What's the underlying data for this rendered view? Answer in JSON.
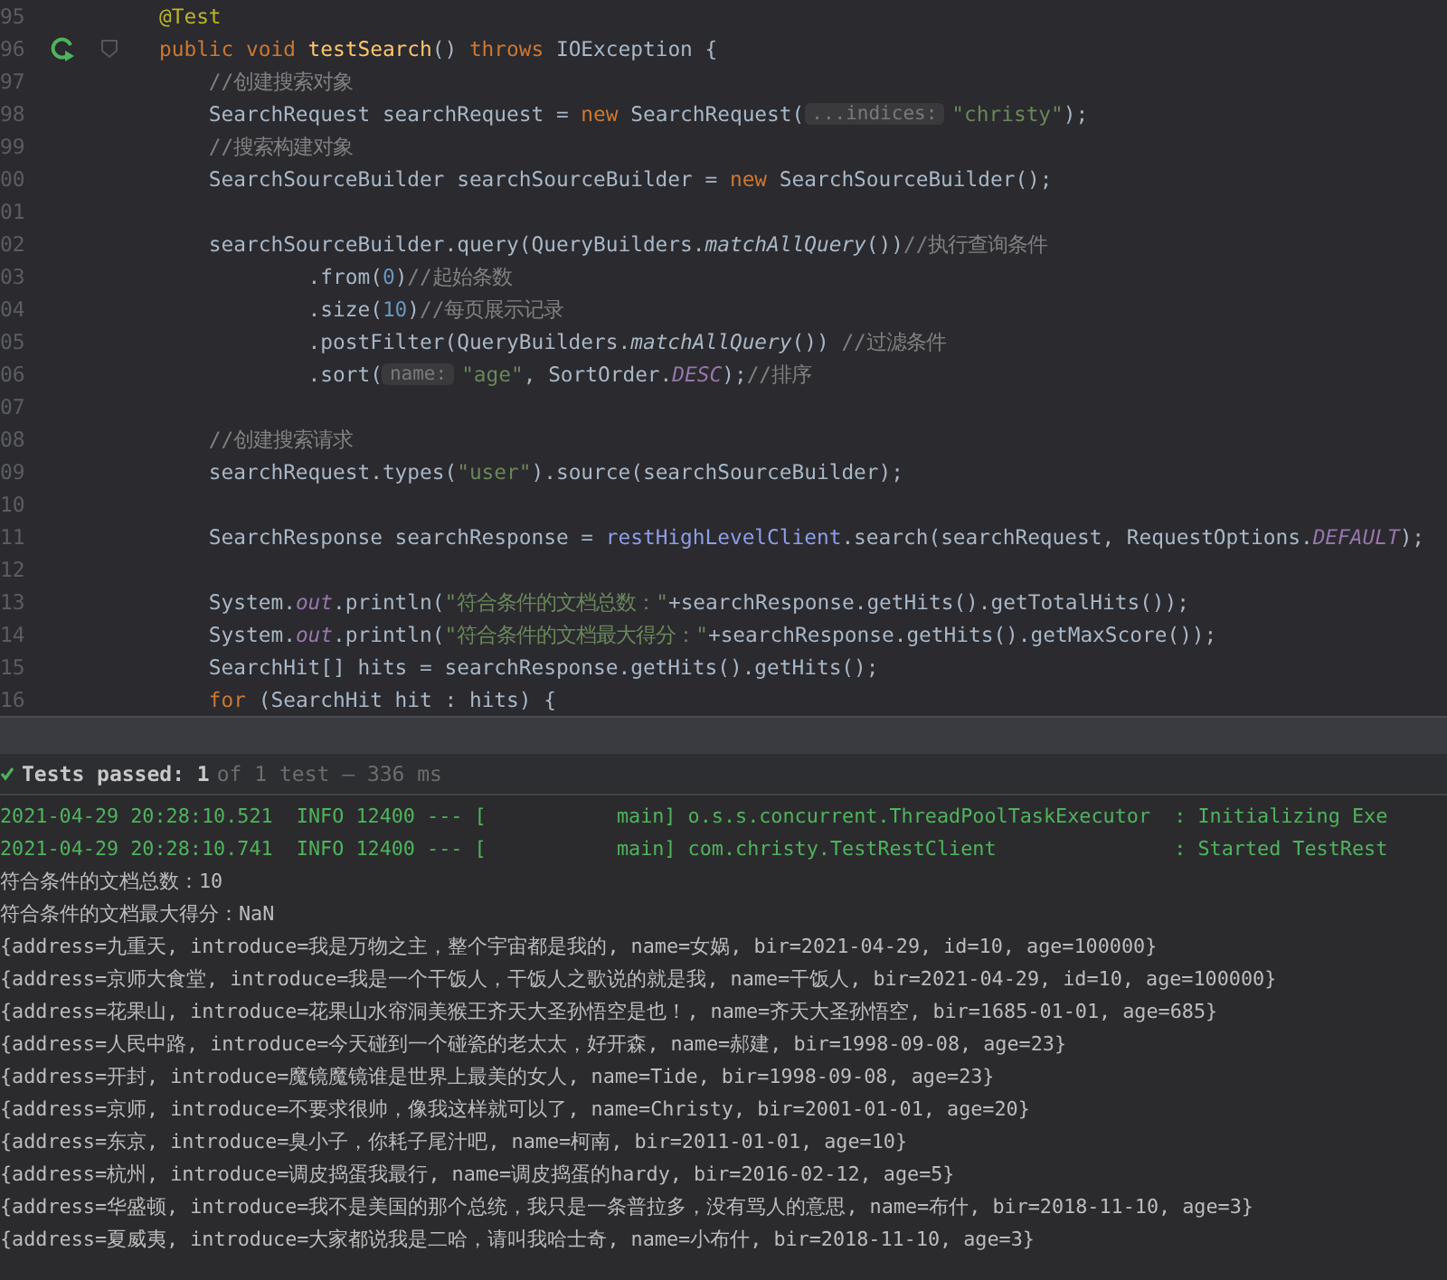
{
  "editor": {
    "lines": [
      {
        "number": "95",
        "tokens": [
          {
            "kind": "annotation",
            "text": "@Test"
          }
        ]
      },
      {
        "number": "96",
        "run_marker": true,
        "fold_marker": true,
        "tokens": [
          {
            "kind": "keyword",
            "text": "public void "
          },
          {
            "kind": "method",
            "text": "testSearch"
          },
          {
            "kind": "plain",
            "text": "() "
          },
          {
            "kind": "keyword",
            "text": "throws "
          },
          {
            "kind": "plain",
            "text": "IOException {"
          }
        ]
      },
      {
        "number": "97",
        "tokens": [
          {
            "kind": "comment",
            "text": "    //创建搜索对象"
          }
        ]
      },
      {
        "number": "98",
        "tokens": [
          {
            "kind": "plain",
            "text": "    SearchRequest searchRequest = "
          },
          {
            "kind": "keyword",
            "text": "new "
          },
          {
            "kind": "plain",
            "text": "SearchRequest("
          },
          {
            "kind": "hint",
            "text": "...indices:"
          },
          {
            "kind": "string",
            "text": "\"christy\""
          },
          {
            "kind": "plain",
            "text": ");"
          }
        ]
      },
      {
        "number": "99",
        "tokens": [
          {
            "kind": "comment",
            "text": "    //搜索构建对象"
          }
        ]
      },
      {
        "number": "00",
        "tokens": [
          {
            "kind": "plain",
            "text": "    SearchSourceBuilder searchSourceBuilder = "
          },
          {
            "kind": "keyword",
            "text": "new "
          },
          {
            "kind": "plain",
            "text": "SearchSourceBuilder();"
          }
        ]
      },
      {
        "number": "01"
      },
      {
        "number": "02",
        "tokens": [
          {
            "kind": "plain",
            "text": "    searchSourceBuilder.query(QueryBuilders."
          },
          {
            "kind": "italic",
            "text": "matchAllQuery"
          },
          {
            "kind": "plain",
            "text": "())"
          },
          {
            "kind": "comment",
            "text": "//执行查询条件"
          }
        ]
      },
      {
        "number": "03",
        "tokens": [
          {
            "kind": "plain",
            "text": "            .from("
          },
          {
            "kind": "number",
            "text": "0"
          },
          {
            "kind": "plain",
            "text": ")"
          },
          {
            "kind": "comment",
            "text": "//起始条数"
          }
        ]
      },
      {
        "number": "04",
        "tokens": [
          {
            "kind": "plain",
            "text": "            .size("
          },
          {
            "kind": "number",
            "text": "10"
          },
          {
            "kind": "plain",
            "text": ")"
          },
          {
            "kind": "comment",
            "text": "//每页展示记录"
          }
        ]
      },
      {
        "number": "05",
        "tokens": [
          {
            "kind": "plain",
            "text": "            .postFilter(QueryBuilders."
          },
          {
            "kind": "italic",
            "text": "matchAllQuery"
          },
          {
            "kind": "plain",
            "text": "()) "
          },
          {
            "kind": "comment",
            "text": "//过滤条件"
          }
        ]
      },
      {
        "number": "06",
        "tokens": [
          {
            "kind": "plain",
            "text": "            .sort("
          },
          {
            "kind": "hint",
            "text": "name:"
          },
          {
            "kind": "string",
            "text": "\"age\""
          },
          {
            "kind": "plain",
            "text": ", SortOrder."
          },
          {
            "kind": "static",
            "text": "DESC"
          },
          {
            "kind": "plain",
            "text": ");"
          },
          {
            "kind": "comment",
            "text": "//排序"
          }
        ]
      },
      {
        "number": "07"
      },
      {
        "number": "08",
        "tokens": [
          {
            "kind": "comment",
            "text": "    //创建搜索请求"
          }
        ]
      },
      {
        "number": "09",
        "tokens": [
          {
            "kind": "plain",
            "text": "    searchRequest.types("
          },
          {
            "kind": "string",
            "text": "\"user\""
          },
          {
            "kind": "plain",
            "text": ").source(searchSourceBuilder);"
          }
        ]
      },
      {
        "number": "10"
      },
      {
        "number": "11",
        "tokens": [
          {
            "kind": "plain",
            "text": "    SearchResponse searchResponse = "
          },
          {
            "kind": "field",
            "text": "restHighLevelClient"
          },
          {
            "kind": "plain",
            "text": ".search(searchRequest, RequestOptions."
          },
          {
            "kind": "static",
            "text": "DEFAULT"
          },
          {
            "kind": "plain",
            "text": ");"
          }
        ]
      },
      {
        "number": "12"
      },
      {
        "number": "13",
        "tokens": [
          {
            "kind": "plain",
            "text": "    System."
          },
          {
            "kind": "static",
            "text": "out"
          },
          {
            "kind": "plain",
            "text": ".println("
          },
          {
            "kind": "string",
            "text": "\"符合条件的文档总数：\""
          },
          {
            "kind": "plain",
            "text": "+searchResponse.getHits().getTotalHits());"
          }
        ]
      },
      {
        "number": "14",
        "tokens": [
          {
            "kind": "plain",
            "text": "    System."
          },
          {
            "kind": "static",
            "text": "out"
          },
          {
            "kind": "plain",
            "text": ".println("
          },
          {
            "kind": "string",
            "text": "\"符合条件的文档最大得分：\""
          },
          {
            "kind": "plain",
            "text": "+searchResponse.getHits().getMaxScore());"
          }
        ]
      },
      {
        "number": "15",
        "tokens": [
          {
            "kind": "plain",
            "text": "    SearchHit[] hits = searchResponse.getHits().getHits();"
          }
        ]
      },
      {
        "number": "16",
        "tokens": [
          {
            "kind": "keyword",
            "text": "    for "
          },
          {
            "kind": "plain",
            "text": "(SearchHit hit : hits) {"
          }
        ]
      }
    ]
  },
  "test_status": {
    "passed": true,
    "label": "Tests passed:",
    "count": "1",
    "detail": "of 1 test – 336 ms"
  },
  "console": {
    "lines": [
      {
        "kind": "log",
        "text": "2021-04-29 20:28:10.521  INFO 12400 --- [           main] o.s.s.concurrent.ThreadPoolTaskExecutor  : Initializing Exe"
      },
      {
        "kind": "log",
        "text": "2021-04-29 20:28:10.741  INFO 12400 --- [           main] com.christy.TestRestClient               : Started TestRest"
      },
      {
        "kind": "output",
        "text": "符合条件的文档总数：10"
      },
      {
        "kind": "output",
        "text": "符合条件的文档最大得分：NaN"
      },
      {
        "kind": "output",
        "text": "{address=九重天, introduce=我是万物之主，整个宇宙都是我的, name=女娲, bir=2021-04-29, id=10, age=100000}"
      },
      {
        "kind": "output",
        "text": "{address=京师大食堂, introduce=我是一个干饭人，干饭人之歌说的就是我, name=干饭人, bir=2021-04-29, id=10, age=100000}"
      },
      {
        "kind": "output",
        "text": "{address=花果山, introduce=花果山水帘洞美猴王齐天大圣孙悟空是也！, name=齐天大圣孙悟空, bir=1685-01-01, age=685}"
      },
      {
        "kind": "output",
        "text": "{address=人民中路, introduce=今天碰到一个碰瓷的老太太，好开森, name=郝建, bir=1998-09-08, age=23}"
      },
      {
        "kind": "output",
        "text": "{address=开封, introduce=魔镜魔镜谁是世界上最美的女人, name=Tide, bir=1998-09-08, age=23}"
      },
      {
        "kind": "output",
        "text": "{address=京师, introduce=不要求很帅，像我这样就可以了, name=Christy, bir=2001-01-01, age=20}"
      },
      {
        "kind": "output",
        "text": "{address=东京, introduce=臭小子，你耗子尾汁吧, name=柯南, bir=2011-01-01, age=10}"
      },
      {
        "kind": "output",
        "text": "{address=杭州, introduce=调皮捣蛋我最行, name=调皮捣蛋的hardy, bir=2016-02-12, age=5}"
      },
      {
        "kind": "output",
        "text": "{address=华盛顿, introduce=我不是美国的那个总统，我只是一条普拉多，没有骂人的意思, name=布什, bir=2018-11-10, age=3}"
      },
      {
        "kind": "output",
        "text": "{address=夏威夷, introduce=大家都说我是二哈，请叫我哈士奇, name=小布什, bir=2018-11-10, age=3}"
      }
    ]
  }
}
